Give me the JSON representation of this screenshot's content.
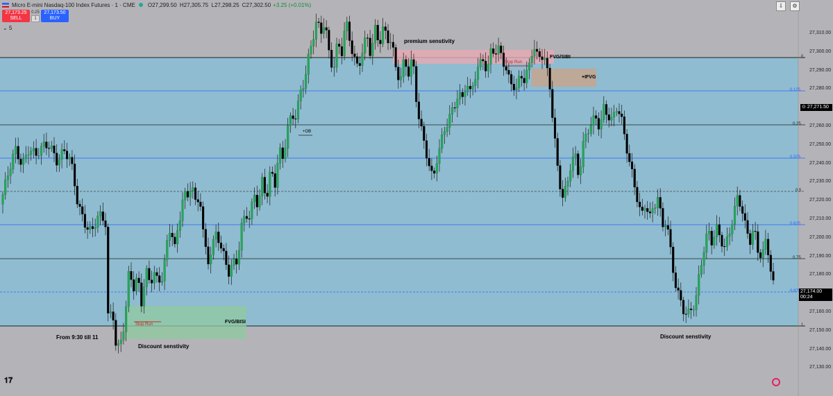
{
  "header": {
    "symbol": "Micro E-mini Nasdaq-100 Index Futures · 1 · CME",
    "open": "O27,299.50",
    "high": "H27,305.75",
    "low": "L27,298.25",
    "close": "C27,302.50",
    "change": "+3.25 (+0.01%)"
  },
  "trade": {
    "sell_price": "27,173.25",
    "sell_label": "SELL",
    "spread": "0.25",
    "qty": "1",
    "buy_price": "27,173.50",
    "buy_label": "BUY"
  },
  "indicators_count": "5",
  "price_axis": [
    "27,310.00",
    "27,300.00",
    "27,290.00",
    "27,280.00",
    "27,270.00",
    "27,260.00",
    "27,250.00",
    "27,240.00",
    "27,230.00",
    "27,220.00",
    "27,210.00",
    "27,200.00",
    "27,190.00",
    "27,180.00",
    "27,170.00",
    "27,160.00",
    "27,150.00",
    "27,140.00",
    "27,130.00"
  ],
  "fib_levels": [
    "0",
    "0.125",
    "0.25",
    "0.375",
    "0.5",
    "0.625",
    "0.75",
    "0.875",
    "1"
  ],
  "price_tags": {
    "top": "27,271.50",
    "last": "27,174.00",
    "countdown": "00:24"
  },
  "annotations": {
    "premium": "premium senstivity",
    "fvg_sibi": "FVG/SIBI",
    "stop_run_top": "Stop Run",
    "ifvg": "+IFVG",
    "ob": "+OB",
    "fvg_bisi": "FVG/BISI",
    "stop_run_bottom": "Stop Run",
    "from": "From 9:30 till 11",
    "discount_left": "Discount senstivity",
    "discount_right": "Discount senstivity"
  },
  "colors": {
    "up": "#26a65b",
    "down": "#000000",
    "fib_area": "#8fbcd0",
    "fib_blue": "#2962ff"
  },
  "chart_data": {
    "type": "candlestick",
    "ylim": [
      27125,
      27317
    ],
    "close_path": [
      [
        0,
        27218
      ],
      [
        12,
        27232
      ],
      [
        22,
        27244
      ],
      [
        32,
        27238
      ],
      [
        42,
        27246
      ],
      [
        52,
        27241
      ],
      [
        62,
        27245
      ],
      [
        72,
        27247
      ],
      [
        82,
        27240
      ],
      [
        92,
        27244
      ],
      [
        102,
        27238
      ],
      [
        112,
        27218
      ],
      [
        122,
        27210
      ],
      [
        132,
        27205
      ],
      [
        142,
        27212
      ],
      [
        152,
        27208
      ],
      [
        156,
        27160
      ],
      [
        162,
        27168
      ],
      [
        168,
        27148
      ],
      [
        174,
        27152
      ],
      [
        180,
        27162
      ],
      [
        186,
        27185
      ],
      [
        192,
        27176
      ],
      [
        198,
        27182
      ],
      [
        204,
        27170
      ],
      [
        210,
        27188
      ],
      [
        216,
        27180
      ],
      [
        222,
        27186
      ],
      [
        228,
        27178
      ],
      [
        234,
        27182
      ],
      [
        240,
        27196
      ],
      [
        246,
        27208
      ],
      [
        252,
        27198
      ],
      [
        258,
        27210
      ],
      [
        264,
        27224
      ],
      [
        270,
        27220
      ],
      [
        276,
        27228
      ],
      [
        282,
        27216
      ],
      [
        288,
        27222
      ],
      [
        294,
        27200
      ],
      [
        300,
        27192
      ],
      [
        306,
        27198
      ],
      [
        312,
        27205
      ],
      [
        318,
        27196
      ],
      [
        324,
        27190
      ],
      [
        330,
        27184
      ],
      [
        336,
        27190
      ],
      [
        342,
        27192
      ],
      [
        348,
        27208
      ],
      [
        354,
        27214
      ],
      [
        360,
        27210
      ],
      [
        366,
        27222
      ],
      [
        372,
        27216
      ],
      [
        378,
        27230
      ],
      [
        384,
        27222
      ],
      [
        390,
        27236
      ],
      [
        396,
        27228
      ],
      [
        402,
        27244
      ],
      [
        408,
        27238
      ],
      [
        414,
        27254
      ],
      [
        420,
        27260
      ],
      [
        426,
        27262
      ],
      [
        432,
        27272
      ],
      [
        438,
        27278
      ],
      [
        444,
        27288
      ],
      [
        450,
        27296
      ],
      [
        456,
        27306
      ],
      [
        462,
        27300
      ],
      [
        468,
        27308
      ],
      [
        474,
        27292
      ],
      [
        480,
        27284
      ],
      [
        486,
        27296
      ],
      [
        492,
        27290
      ],
      [
        498,
        27306
      ],
      [
        504,
        27296
      ],
      [
        510,
        27290
      ],
      [
        516,
        27284
      ],
      [
        522,
        27294
      ],
      [
        528,
        27300
      ],
      [
        534,
        27290
      ],
      [
        540,
        27302
      ],
      [
        546,
        27294
      ],
      [
        552,
        27304
      ],
      [
        558,
        27298
      ],
      [
        564,
        27300
      ],
      [
        570,
        27284
      ],
      [
        576,
        27278
      ],
      [
        582,
        27286
      ],
      [
        588,
        27280
      ],
      [
        594,
        27290
      ],
      [
        600,
        27268
      ],
      [
        606,
        27258
      ],
      [
        612,
        27246
      ],
      [
        618,
        27238
      ],
      [
        624,
        27228
      ],
      [
        630,
        27240
      ],
      [
        636,
        27248
      ],
      [
        642,
        27256
      ],
      [
        648,
        27262
      ],
      [
        654,
        27266
      ],
      [
        660,
        27272
      ],
      [
        666,
        27268
      ],
      [
        672,
        27276
      ],
      [
        678,
        27270
      ],
      [
        684,
        27280
      ],
      [
        690,
        27286
      ],
      [
        696,
        27290
      ],
      [
        702,
        27282
      ],
      [
        708,
        27294
      ],
      [
        714,
        27290
      ],
      [
        720,
        27292
      ],
      [
        726,
        27286
      ],
      [
        732,
        27280
      ],
      [
        738,
        27278
      ],
      [
        744,
        27274
      ],
      [
        750,
        27282
      ],
      [
        756,
        27276
      ],
      [
        762,
        27284
      ],
      [
        768,
        27294
      ],
      [
        774,
        27290
      ],
      [
        780,
        27292
      ],
      [
        786,
        27288
      ],
      [
        792,
        27276
      ],
      [
        798,
        27252
      ],
      [
        804,
        27232
      ],
      [
        810,
        27220
      ],
      [
        816,
        27226
      ],
      [
        822,
        27238
      ],
      [
        828,
        27244
      ],
      [
        834,
        27232
      ],
      [
        840,
        27246
      ],
      [
        846,
        27252
      ],
      [
        852,
        27256
      ],
      [
        858,
        27260
      ],
      [
        864,
        27256
      ],
      [
        870,
        27266
      ],
      [
        876,
        27262
      ],
      [
        882,
        27258
      ],
      [
        888,
        27264
      ],
      [
        894,
        27260
      ],
      [
        900,
        27250
      ],
      [
        906,
        27240
      ],
      [
        912,
        27232
      ],
      [
        918,
        27222
      ],
      [
        924,
        27212
      ],
      [
        930,
        27218
      ],
      [
        936,
        27210
      ],
      [
        942,
        27216
      ],
      [
        948,
        27222
      ],
      [
        954,
        27208
      ],
      [
        960,
        27212
      ],
      [
        966,
        27196
      ],
      [
        972,
        27180
      ],
      [
        978,
        27172
      ],
      [
        984,
        27166
      ],
      [
        990,
        27164
      ],
      [
        996,
        27168
      ],
      [
        1002,
        27172
      ],
      [
        1008,
        27186
      ],
      [
        1014,
        27196
      ],
      [
        1020,
        27204
      ],
      [
        1026,
        27198
      ],
      [
        1032,
        27206
      ],
      [
        1038,
        27202
      ],
      [
        1044,
        27198
      ],
      [
        1050,
        27204
      ],
      [
        1056,
        27212
      ],
      [
        1062,
        27220
      ],
      [
        1068,
        27216
      ],
      [
        1074,
        27206
      ],
      [
        1080,
        27200
      ],
      [
        1086,
        27208
      ],
      [
        1092,
        27196
      ],
      [
        1098,
        27194
      ],
      [
        1104,
        27200
      ],
      [
        1110,
        27186
      ],
      [
        1116,
        27174
      ]
    ]
  }
}
